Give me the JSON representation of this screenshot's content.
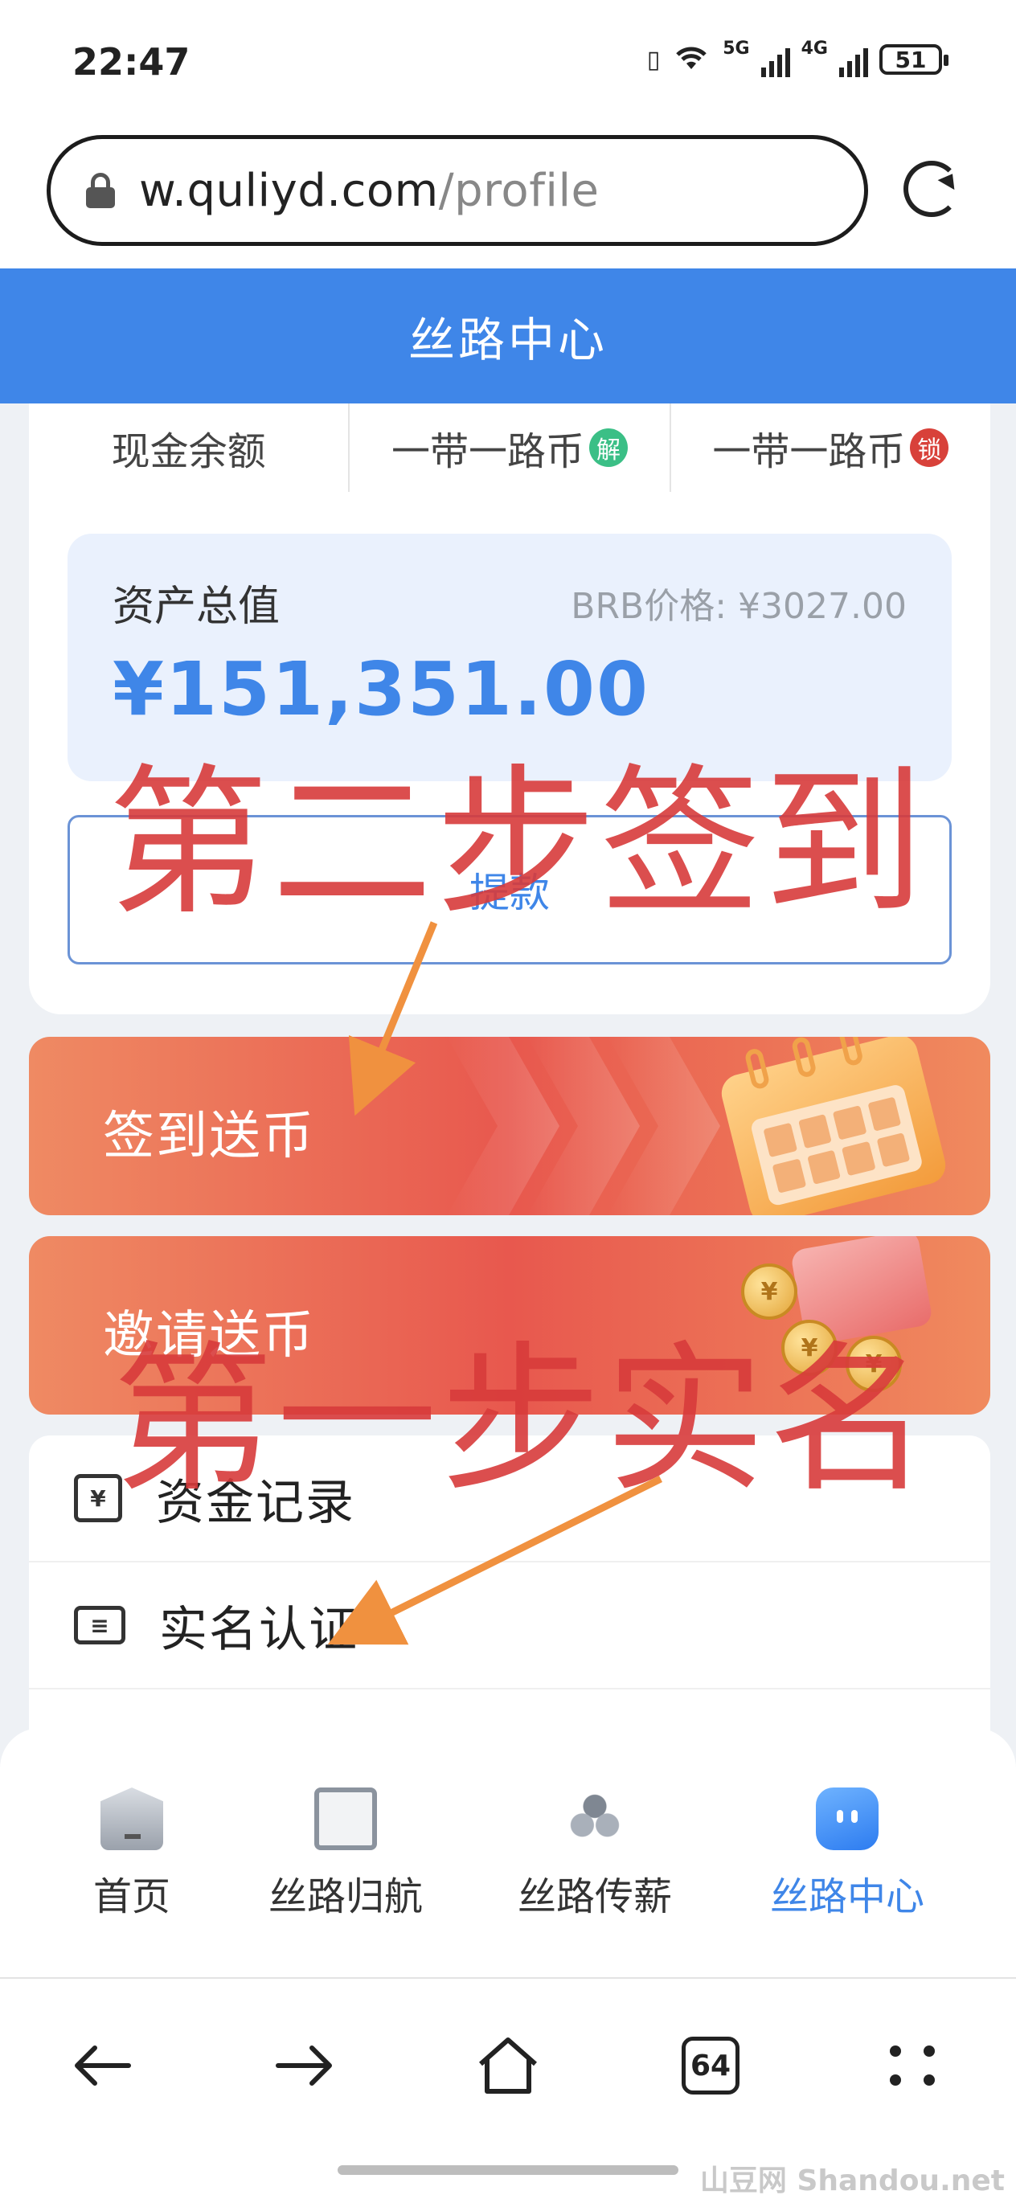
{
  "status_bar": {
    "time": "22:47",
    "net1": "5G",
    "net2": "4G",
    "battery": "51"
  },
  "browser": {
    "url_domain": "w.quliyd.com",
    "url_path": "/profile",
    "tab_count": "64"
  },
  "page": {
    "title": "丝路中心",
    "tabs": [
      {
        "label": "现金余额",
        "badge": ""
      },
      {
        "label": "一带一路币",
        "badge": "解",
        "badge_color": "#3bbf86"
      },
      {
        "label": "一带一路币",
        "badge": "锁",
        "badge_color": "#d8413a"
      }
    ],
    "asset": {
      "label": "资产总值",
      "price": "BRB价格: ¥3027.00",
      "value": "¥151,351.00"
    },
    "withdraw_label": "提款",
    "banners": {
      "checkin": "签到送币",
      "invite": "邀请送币"
    },
    "menu": [
      {
        "label": "资金记录",
        "icon": "fund-record-icon"
      },
      {
        "label": "实名认证",
        "icon": "id-card-icon"
      }
    ]
  },
  "tabbar": {
    "items": [
      {
        "label": "首页",
        "icon": "home-icon"
      },
      {
        "label": "丝路归航",
        "icon": "clipboard-icon"
      },
      {
        "label": "丝路传薪",
        "icon": "people-icon"
      },
      {
        "label": "丝路中心",
        "icon": "bot-icon",
        "active": true
      }
    ]
  },
  "annotations": {
    "step2": "第二步签到",
    "step1": "第一步实名",
    "color": "#d83b3b",
    "arrow_color": "#f0913f"
  },
  "watermark": "山豆网 Shandou.net",
  "colors": {
    "accent": "#3f86e8",
    "banner": "#e8584e"
  }
}
